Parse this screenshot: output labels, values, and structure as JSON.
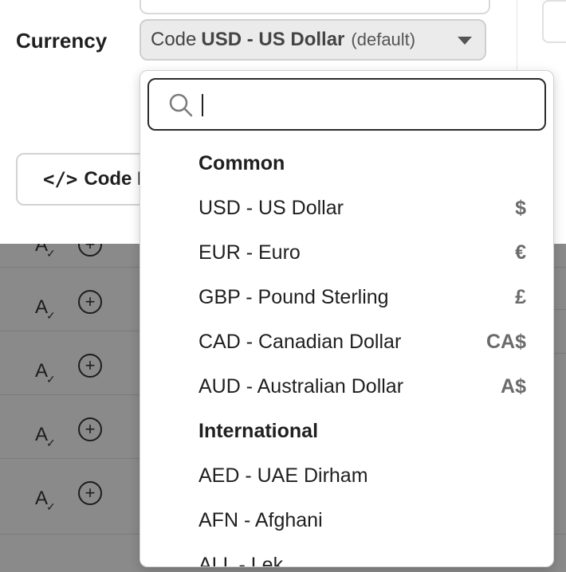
{
  "form": {
    "currency_label": "Currency",
    "select": {
      "prefix": "Code",
      "selected": "USD - US Dollar",
      "suffix": "(default)"
    },
    "code_button_label": "Code E"
  },
  "dropdown": {
    "search": {
      "placeholder": "",
      "value": ""
    },
    "groups": [
      {
        "title": "Common",
        "options": [
          {
            "label": "USD - US Dollar",
            "symbol": "$"
          },
          {
            "label": "EUR - Euro",
            "symbol": "€"
          },
          {
            "label": "GBP - Pound Sterling",
            "symbol": "£"
          },
          {
            "label": "CAD - Canadian Dollar",
            "symbol": "CA$"
          },
          {
            "label": "AUD - Australian Dollar",
            "symbol": "A$"
          }
        ]
      },
      {
        "title": "International",
        "options": [
          {
            "label": "AED - UAE Dirham",
            "symbol": ""
          },
          {
            "label": "AFN - Afghani",
            "symbol": ""
          },
          {
            "label": "ALL - Lek",
            "symbol": ""
          }
        ]
      }
    ]
  },
  "icons": {
    "search": "search-icon",
    "code": "code-icon",
    "caret": "chevron-down-icon",
    "row_a": "text-format-icon",
    "row_plus": "add-circle-icon"
  },
  "colors": {
    "overlay": "#8a8a8a",
    "select_bg": "#ebebeb",
    "search_border": "#2b2b2b",
    "symbol": "#6b6b6b"
  }
}
